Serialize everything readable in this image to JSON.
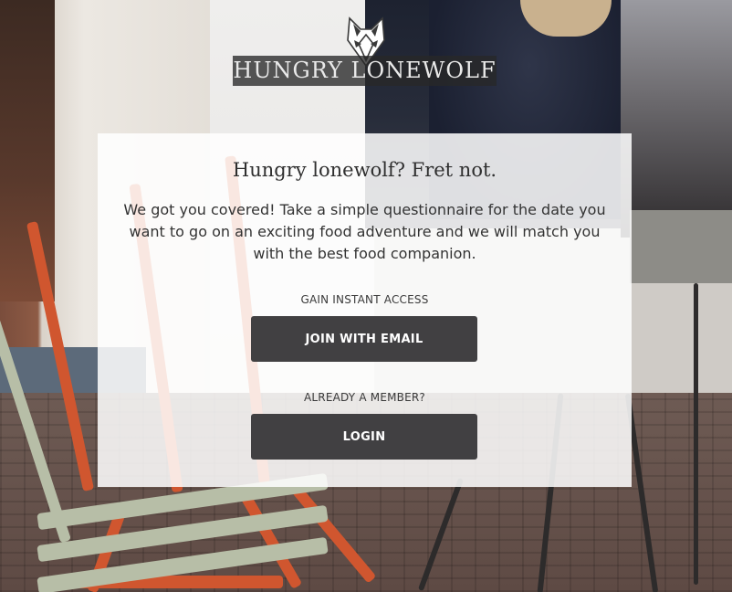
{
  "brand": {
    "name": "HUNGRY LONEWOLF",
    "logo_icon": "wolf-head-icon"
  },
  "card": {
    "headline": "Hungry lonewolf? Fret not.",
    "blurb": "We got you covered! Take a simple questionnaire for the date you want to go on an exciting food adventure and we will match you with the best food companion.",
    "signup_label": "GAIN INSTANT ACCESS",
    "join_button": "JOIN WITH EMAIL",
    "member_label": "ALREADY A MEMBER?",
    "login_button": "LOGIN"
  },
  "colors": {
    "button_bg": "#414042",
    "button_text": "#ffffff",
    "card_bg": "rgba(255,255,255,0.86)"
  }
}
